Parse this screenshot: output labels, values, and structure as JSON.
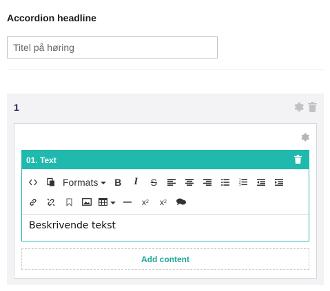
{
  "headline": "Accordion headline",
  "title_input": {
    "placeholder": "Titel på høring",
    "value": ""
  },
  "block": {
    "number": "1",
    "editor": {
      "title": "01. Text",
      "toolbar": {
        "row1": [
          "source-code",
          "paste",
          "formats",
          "bold",
          "italic",
          "strikethrough",
          "align-left",
          "align-center",
          "align-right",
          "bullet-list",
          "numbered-list",
          "outdent",
          "indent"
        ],
        "formats_label": "Formats",
        "row2": [
          "link",
          "unlink",
          "anchor",
          "image",
          "table",
          "horizontal-rule",
          "subscript",
          "superscript",
          "embed"
        ]
      },
      "content": "Beskrivende tekst"
    },
    "add_content_label": "Add content"
  },
  "colors": {
    "accent": "#1fb9ae",
    "add_content": "#1fa79d",
    "block_bg": "#f3f3f5"
  }
}
